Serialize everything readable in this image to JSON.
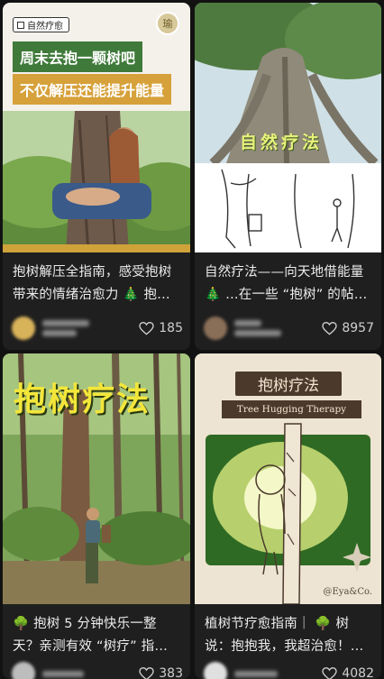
{
  "feed": {
    "cards": [
      {
        "title": "抱树解压全指南，感受抱树带来的情绪治愈力 🎄 抱…",
        "likes": "185",
        "image": {
          "tag": "自然疗愈",
          "logo": "瑜",
          "line1": "周末去抱一颗树吧",
          "line2": "不仅解压还能提升能量"
        },
        "avatar_color": "#d9b35a"
      },
      {
        "title": "自然疗法——向天地借能量 🎄 …在一些 “抱树” 的帖…",
        "likes": "8957",
        "image": {
          "heading": "自然疗法"
        },
        "avatar_color": "#8a6f58"
      },
      {
        "title": "🌳 抱树 5 分钟快乐一整天？亲测有效 “树疗” 指…",
        "likes": "383",
        "image": {
          "heading": "抱树疗法"
        },
        "avatar_color": "#bdbdbd"
      },
      {
        "title": "植树节疗愈指南｜ 🌳 树说：抱抱我，我超治愈！…",
        "likes": "4082",
        "image": {
          "heading": "抱树疗法",
          "subheading": "Tree Hugging Therapy",
          "signature": "@Eya&Co."
        },
        "avatar_color": "#e0e0e0"
      }
    ]
  }
}
